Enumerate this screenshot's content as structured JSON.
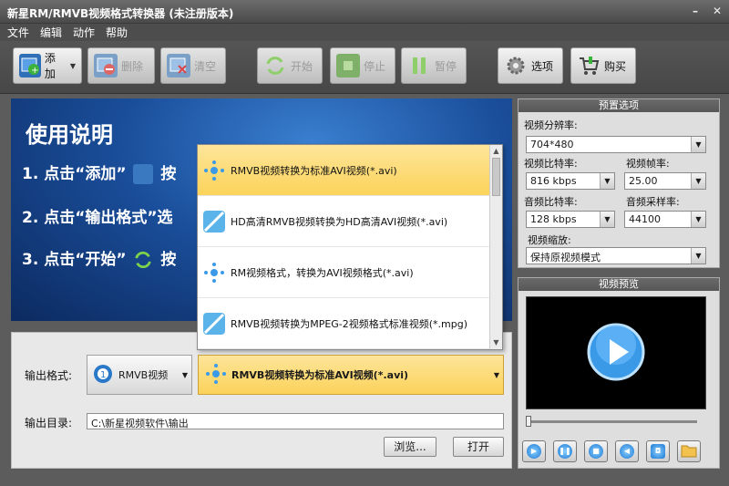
{
  "window": {
    "title": "新星RM/RMVB视频格式转换器 (未注册版本)"
  },
  "menu": [
    "文件",
    "编辑",
    "动作",
    "帮助"
  ],
  "toolbar": {
    "add": "添加",
    "delete": "删除",
    "clear": "清空",
    "start": "开始",
    "stop": "停止",
    "pause": "暂停",
    "options": "选项",
    "buy": "购买"
  },
  "guide": {
    "title": "使用说明",
    "step1": "1. 点击“添加”",
    "step1_tail": "按",
    "step2": "2. 点击“输出格式”选",
    "step3": "3. 点击“开始”",
    "step3_tail": "按"
  },
  "format_list": {
    "items": [
      "RMVB视频转换为标准AVI视频(*.avi)",
      "HD高清RMVB视频转换为HD高清AVI视频(*.avi)",
      "RM视频格式，转换为AVI视频格式(*.avi)",
      "RMVB视频转换为MPEG-2视频格式标准视频(*.mpg)"
    ],
    "selected_index": 0
  },
  "output": {
    "format_label": "输出格式:",
    "format_value": "RMVB视频",
    "preset_value": "RMVB视频转换为标准AVI视频(*.avi)",
    "dir_label": "输出目录:",
    "dir_value": "C:\\新星视频软件\\输出",
    "browse": "浏览...",
    "open": "打开"
  },
  "presets": {
    "header": "预置选项",
    "resolution_label": "视频分辨率:",
    "resolution": "704*480",
    "vbitrate_label": "视频比特率:",
    "vbitrate": "816 kbps",
    "framerate_label": "视频帧率:",
    "framerate": "25.00",
    "abitrate_label": "音频比特率:",
    "abitrate": "128 kbps",
    "samplerate_label": "音频采样率:",
    "samplerate": "44100",
    "scale_label": "视频缩放:",
    "scale": "保持原视频模式"
  },
  "preview": {
    "header": "视频预览",
    "seek_position": 0
  },
  "icons": {
    "add": "film-add-icon",
    "delete": "film-delete-icon",
    "clear": "film-clear-icon",
    "start": "refresh-icon",
    "stop": "stop-icon",
    "pause": "pause-icon",
    "options": "gear-icon",
    "buy": "cart-icon"
  },
  "colors": {
    "highlight": "#fcd35a",
    "accent_blue": "#1a78d4",
    "dark_bg": "#5c5c5c"
  }
}
